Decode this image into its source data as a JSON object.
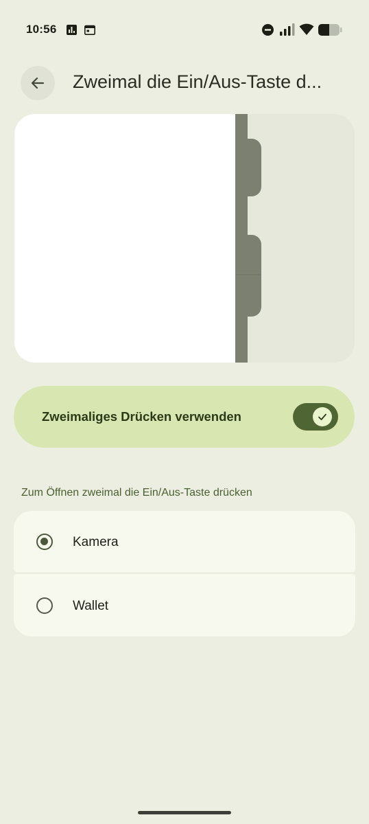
{
  "status_bar": {
    "time": "10:56",
    "left_icons": [
      "bar-chart-icon",
      "calendar-icon"
    ],
    "right_icons": [
      "do-not-disturb-icon",
      "signal-icon",
      "wifi-icon",
      "battery-icon"
    ],
    "battery_level": 0.45
  },
  "header": {
    "back_icon": "arrow-left-icon",
    "title": "Zweimal die Ein/Aus-Taste d..."
  },
  "toggle": {
    "label": "Zweimaliges Drücken verwenden",
    "checked": true,
    "check_icon": "checkmark-icon"
  },
  "section": {
    "label": "Zum Öffnen zweimal die Ein/Aus-Taste drücken"
  },
  "options": [
    {
      "label": "Kamera",
      "selected": true
    },
    {
      "label": "Wallet",
      "selected": false
    }
  ],
  "colors": {
    "background": "#eceee2",
    "toggle_card": "#d8e7b2",
    "switch_track": "#4f6534",
    "accent_text": "#4b6030",
    "option_bg": "#f7f8ee",
    "device_edge": "#7b8070"
  }
}
